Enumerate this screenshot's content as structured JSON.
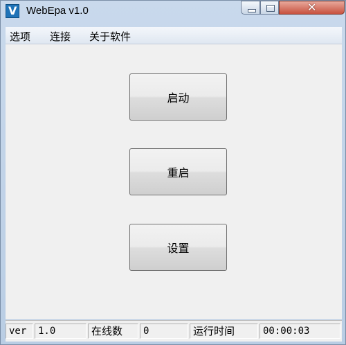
{
  "window": {
    "title": "WebEpa v1.0",
    "close_glyph": "✕",
    "app_icon_letter": "V"
  },
  "menu": {
    "items": [
      "选项",
      "连接",
      "关于软件"
    ]
  },
  "buttons": {
    "start": "启动",
    "restart": "重启",
    "settings": "设置"
  },
  "status": {
    "ver_label": "ver",
    "ver_value": "1.0",
    "online_label": "在线数",
    "online_value": "0",
    "runtime_label": "运行时间",
    "runtime_value": "00:00:03"
  },
  "colors": {
    "frame": "#b9cde4",
    "close_button": "#c7523f",
    "client": "#f0f0f0"
  }
}
